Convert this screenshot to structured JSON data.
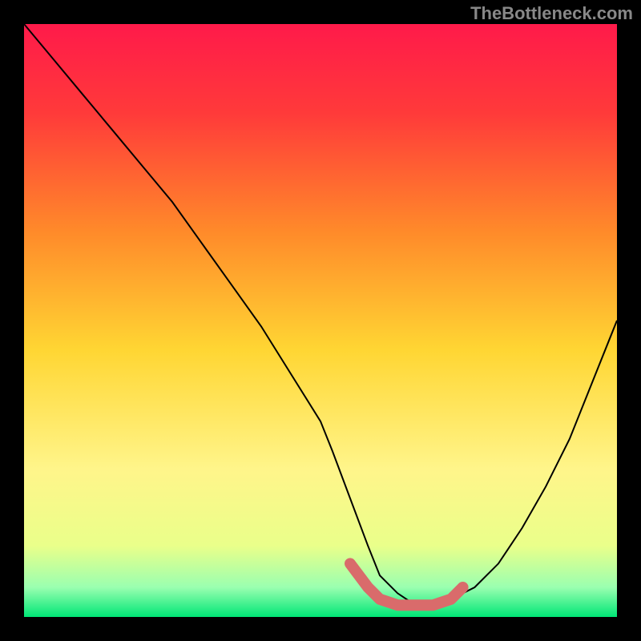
{
  "watermark": "TheBottleneck.com",
  "chart_data": {
    "type": "line",
    "title": "",
    "xlabel": "",
    "ylabel": "",
    "xlim": [
      0,
      100
    ],
    "ylim": [
      0,
      100
    ],
    "background_gradient": {
      "top": "#ff1a4a",
      "mid_upper": "#ff6a2a",
      "mid": "#ffd633",
      "mid_lower": "#fff58a",
      "bottom": "#00e676"
    },
    "series": [
      {
        "name": "bottleneck-curve",
        "color": "#000000",
        "x": [
          0,
          5,
          10,
          15,
          20,
          25,
          30,
          35,
          40,
          45,
          50,
          52,
          55,
          58,
          60,
          63,
          66,
          69,
          72,
          76,
          80,
          84,
          88,
          92,
          96,
          100
        ],
        "values": [
          100,
          94,
          88,
          82,
          76,
          70,
          63,
          56,
          49,
          41,
          33,
          28,
          20,
          12,
          7,
          4,
          2,
          2,
          3,
          5,
          9,
          15,
          22,
          30,
          40,
          50
        ]
      }
    ],
    "highlight": {
      "name": "optimal-zone",
      "color": "#d96b6b",
      "x": [
        55,
        58,
        60,
        63,
        66,
        69,
        72,
        74
      ],
      "values": [
        9,
        5,
        3,
        2,
        2,
        2,
        3,
        5
      ]
    }
  }
}
